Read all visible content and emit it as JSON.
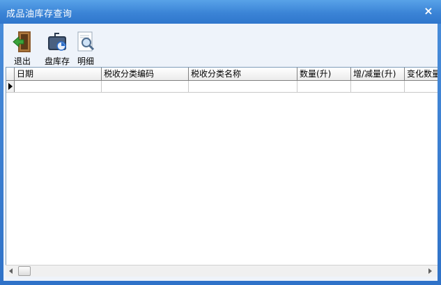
{
  "window": {
    "title": "成品油库存查询",
    "close_glyph": "×"
  },
  "toolbar": {
    "exit_label": "退出",
    "inventory_label": "盘库存",
    "detail_label": "明细"
  },
  "grid": {
    "columns": [
      "日期",
      "税收分类编码",
      "税收分类名称",
      "数量(升)",
      "增/减量(升)",
      "变化数量"
    ]
  },
  "colors": {
    "title_bar": "#3b84d6",
    "client_bg": "#eef3fa"
  }
}
